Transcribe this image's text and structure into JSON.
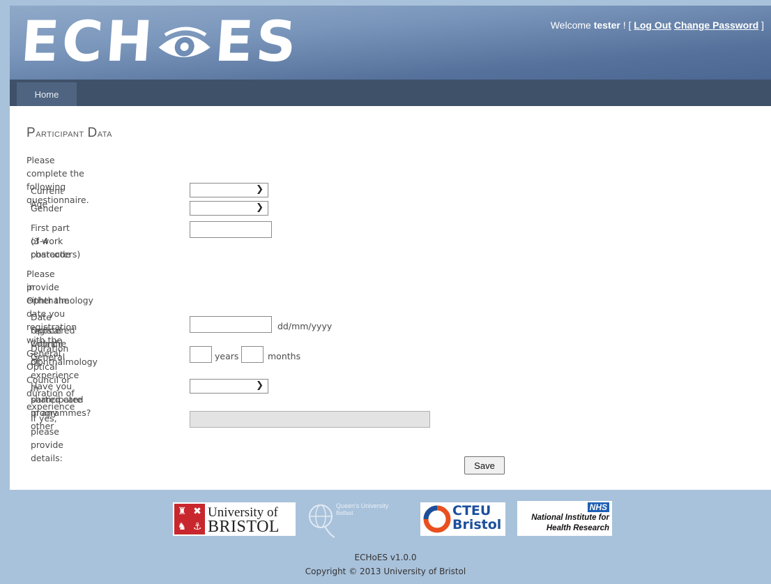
{
  "header": {
    "logo_text": "ECHoES",
    "welcome_prefix": "Welcome ",
    "username": "tester",
    "welcome_suffix": " ! [ ",
    "logout": "Log Out",
    "change_password": "Change Password",
    "bracket_close": " ]"
  },
  "nav": {
    "home": "Home"
  },
  "page": {
    "title_cap1": "P",
    "title_rest1": "articipant ",
    "title_cap2": "D",
    "title_rest2": "ata",
    "intro": "Please complete the following questionnaire.",
    "fields": {
      "current_age": {
        "label": "Current Age",
        "value": ""
      },
      "gender": {
        "label": "Gender",
        "value": ""
      },
      "postcode": {
        "label_line1": "First part of work postcode",
        "label_line2": "(3-4 characters)",
        "value": ""
      },
      "instruction_line1": "Please provide either the date you registration with the General Optical Council or duration of experience",
      "instruction_line2": "in Ophthalmology",
      "date_registered": {
        "label_line1": "Date registered with the General",
        "label_line2": "Optical Council",
        "value": "",
        "format_hint": "dd/mm/yyyy"
      },
      "experience": {
        "label_line1": "Duration of experience in",
        "label_line2": "Ophthalmology",
        "years_label": "years",
        "months_label": "months",
        "years_value": "",
        "months_value": ""
      },
      "shared_care": {
        "label_line1": "Have you participated in any other",
        "label_line2": "shared care programmes?",
        "value": ""
      },
      "details": {
        "label": "If yes, please provide details:",
        "value": ""
      }
    },
    "save_label": "Save"
  },
  "footer": {
    "bristol_line1": "University of",
    "bristol_line2": "BRISTOL",
    "queens_line1": "Queen's University",
    "queens_line2": "Belfast",
    "cteu_line1": "CTEU",
    "cteu_line2": "Bristol",
    "nhs_badge": "NHS",
    "nihr_line1": "National Institute for",
    "nihr_line2": "Health Research",
    "version": "ECHoES v1.0.0",
    "copyright": "Copyright © 2013 University of Bristol"
  },
  "colors": {
    "page_bg": "#a9c2db",
    "header_gradient_start": "#8fa9c8",
    "header_gradient_end": "#4c6791",
    "navbar": "#3f5169",
    "nav_tab": "#4e6480"
  }
}
